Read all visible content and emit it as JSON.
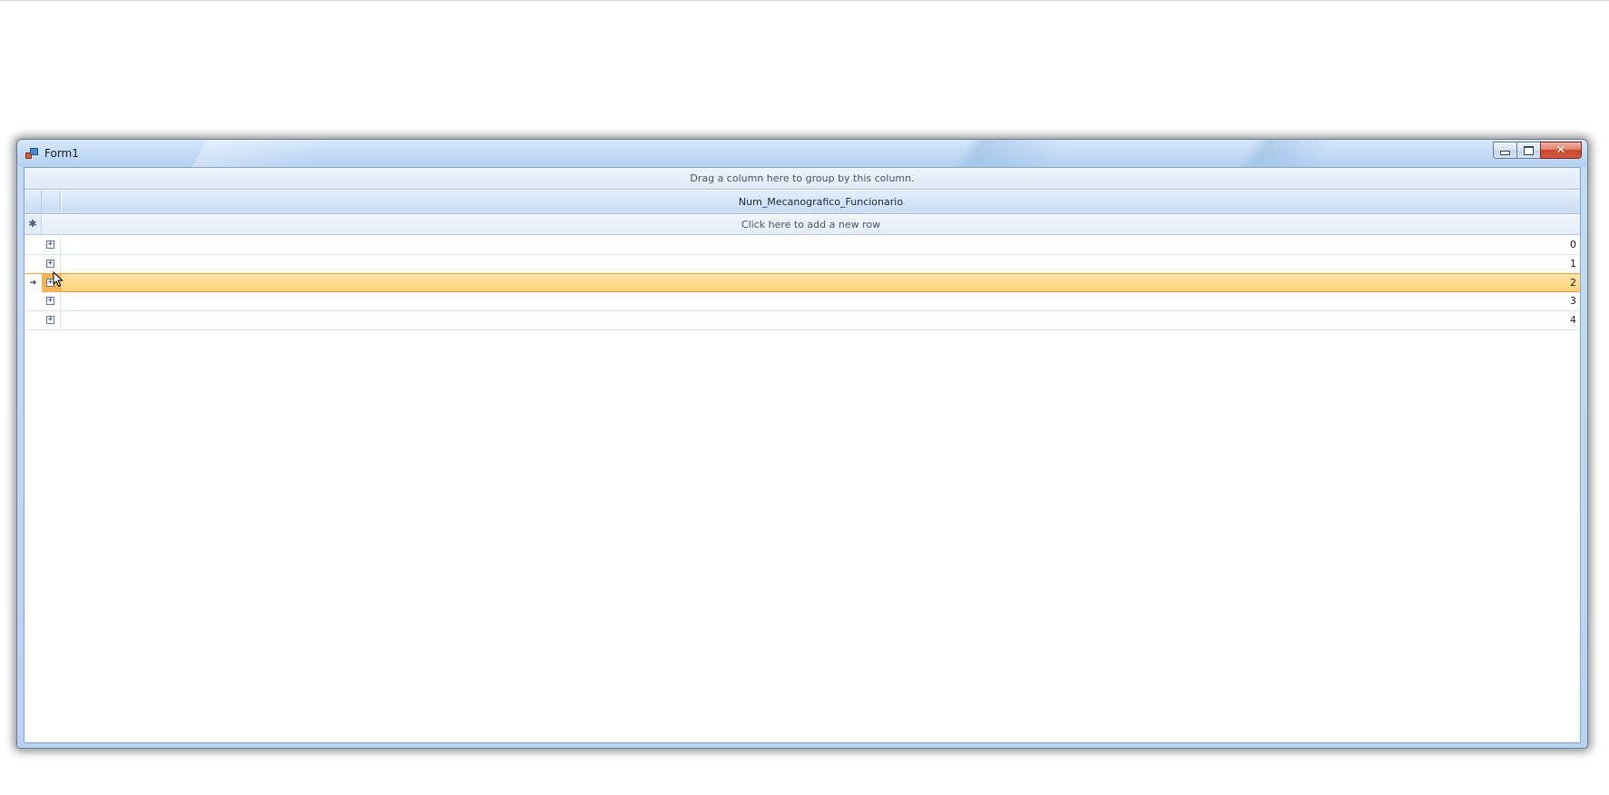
{
  "window": {
    "title": "Form1",
    "controls": {
      "minimize": "minimize",
      "maximize": "maximize",
      "close": "✕"
    }
  },
  "grid": {
    "group_panel_text": "Drag a column here to group by this column.",
    "column_header": "Num_Mecanografico_Funcionario",
    "new_row_indicator": "✱",
    "new_row_text": "Click here to add a new row",
    "current_row_indicator": "➔",
    "expand_glyph": "+",
    "rows": [
      {
        "value": "0",
        "selected": false
      },
      {
        "value": "1",
        "selected": false
      },
      {
        "value": "2",
        "selected": true
      },
      {
        "value": "3",
        "selected": false
      },
      {
        "value": "4",
        "selected": false
      }
    ]
  },
  "colors": {
    "selection": "#ffd27a",
    "selection_border": "#f0a040",
    "titlebar": "#bfd8f5"
  }
}
